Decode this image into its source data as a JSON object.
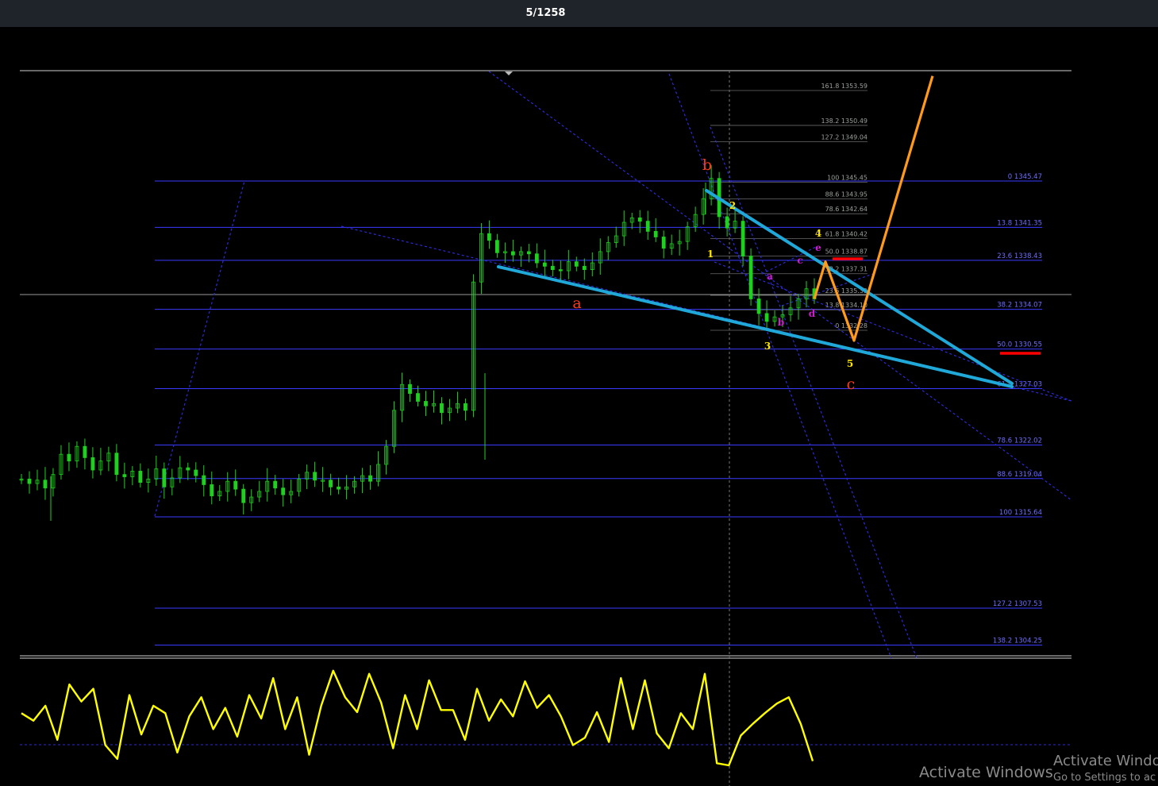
{
  "header": {
    "title": "5/1258"
  },
  "watermark": {
    "main": "Activate Windows",
    "title2": "Activate Windo",
    "sub": "Go to Settings to ac"
  },
  "colors": {
    "background": "#000000",
    "candle": "#1fd11f",
    "fib_main": "#3a3aff",
    "fib_small": "#9aa09a",
    "triangle": "#1fa8d8",
    "projection": "#ff9a1a",
    "wave_red": "#ff3a1a",
    "wave_yellow": "#ffe600",
    "wave_magenta": "#d21ad2",
    "oscillator": "#ffff00",
    "marker_red": "#ff0000"
  },
  "chart_data": {
    "type": "candlestick",
    "price_axis_labels": [
      {
        "level": "0",
        "price": "1345.47"
      },
      {
        "level": "13.8",
        "price": "1341.35"
      },
      {
        "level": "23.6",
        "price": "1338.43"
      },
      {
        "level": "38.2",
        "price": "1334.07"
      },
      {
        "level": "50.0",
        "price": "1330.55"
      },
      {
        "level": "61.8",
        "price": "1327.03"
      },
      {
        "level": "78.6",
        "price": "1322.02"
      },
      {
        "level": "88.6",
        "price": "1319.04"
      },
      {
        "level": "100",
        "price": "1315.64"
      },
      {
        "level": "127.2",
        "price": "1307.53"
      },
      {
        "level": "138.2",
        "price": "1304.25"
      }
    ],
    "fib_extension_labels": [
      {
        "level": "161.8",
        "price": "1353.59"
      },
      {
        "level": "138.2",
        "price": "1350.49"
      },
      {
        "level": "127.2",
        "price": "1349.04"
      },
      {
        "level": "100",
        "price": "1345.45"
      },
      {
        "level": "88.6",
        "price": "1343.95"
      },
      {
        "level": "78.6",
        "price": "1342.64"
      },
      {
        "level": "61.8",
        "price": "1340.42"
      },
      {
        "level": "50.0",
        "price": "1338.87"
      },
      {
        "level": "38.2",
        "price": "1337.31"
      },
      {
        "level": "23.6",
        "price": "1335.39"
      },
      {
        "level": "13.8",
        "price": "1334.10"
      },
      {
        "level": "0",
        "price": "1332.28"
      }
    ],
    "wave_labels": {
      "major": [
        "a",
        "b",
        "c"
      ],
      "minor": [
        "1",
        "2",
        "3",
        "4",
        "5"
      ],
      "sub": [
        "a",
        "b",
        "c",
        "d",
        "e"
      ]
    },
    "price_series": [
      1319.0,
      1318.6,
      1318.9,
      1318.2,
      1319.4,
      1321.2,
      1320.6,
      1321.9,
      1320.9,
      1319.8,
      1320.6,
      1321.3,
      1319.4,
      1319.2,
      1319.7,
      1318.7,
      1319.0,
      1319.9,
      1318.3,
      1319.1,
      1320.0,
      1319.8,
      1319.3,
      1318.5,
      1317.5,
      1317.9,
      1318.8,
      1318.1,
      1316.9,
      1317.4,
      1317.9,
      1318.8,
      1318.2,
      1317.6,
      1317.9,
      1319.0,
      1319.6,
      1318.9,
      1318.9,
      1318.3,
      1318.1,
      1318.3,
      1318.8,
      1319.3,
      1318.8,
      1320.3,
      1321.9,
      1325.1,
      1327.4,
      1326.6,
      1325.9,
      1325.5,
      1325.7,
      1324.9,
      1325.3,
      1325.7,
      1325.1,
      1336.5,
      1340.8,
      1340.2,
      1339.1,
      1339.2,
      1338.9,
      1339.2,
      1339.0,
      1338.2,
      1337.9,
      1337.6,
      1337.5,
      1338.3,
      1337.9,
      1337.6,
      1338.2,
      1339.2,
      1340.0,
      1340.6,
      1341.8,
      1342.2,
      1341.9,
      1341.0,
      1340.5,
      1339.5,
      1339.9,
      1340.1,
      1341.4,
      1342.5,
      1343.9,
      1345.7,
      1342.3,
      1341.3,
      1341.9,
      1338.8,
      1335.0,
      1333.7,
      1333.0,
      1333.4,
      1333.6,
      1334.2,
      1335.0,
      1335.9,
      1335.0
    ],
    "projection_path_prices": [
      1335.0,
      1338.3,
      1331.3,
      1354.8
    ],
    "oscillator_series": [
      0.55,
      0.48,
      0.62,
      0.3,
      0.82,
      0.66,
      0.78,
      0.25,
      0.12,
      0.72,
      0.35,
      0.62,
      0.55,
      0.18,
      0.52,
      0.7,
      0.4,
      0.6,
      0.33,
      0.72,
      0.5,
      0.88,
      0.4,
      0.7,
      0.16,
      0.62,
      0.95,
      0.7,
      0.56,
      0.92,
      0.65,
      0.22,
      0.72,
      0.4,
      0.86,
      0.58,
      0.58,
      0.3,
      0.78,
      0.48,
      0.68,
      0.52,
      0.85,
      0.6,
      0.72,
      0.52,
      0.25,
      0.32,
      0.56,
      0.28,
      0.88,
      0.4,
      0.86,
      0.36,
      0.22,
      0.55,
      0.4,
      0.92,
      0.08,
      0.06,
      0.34,
      0.45,
      0.55,
      0.64,
      0.7,
      0.45,
      0.1
    ]
  }
}
